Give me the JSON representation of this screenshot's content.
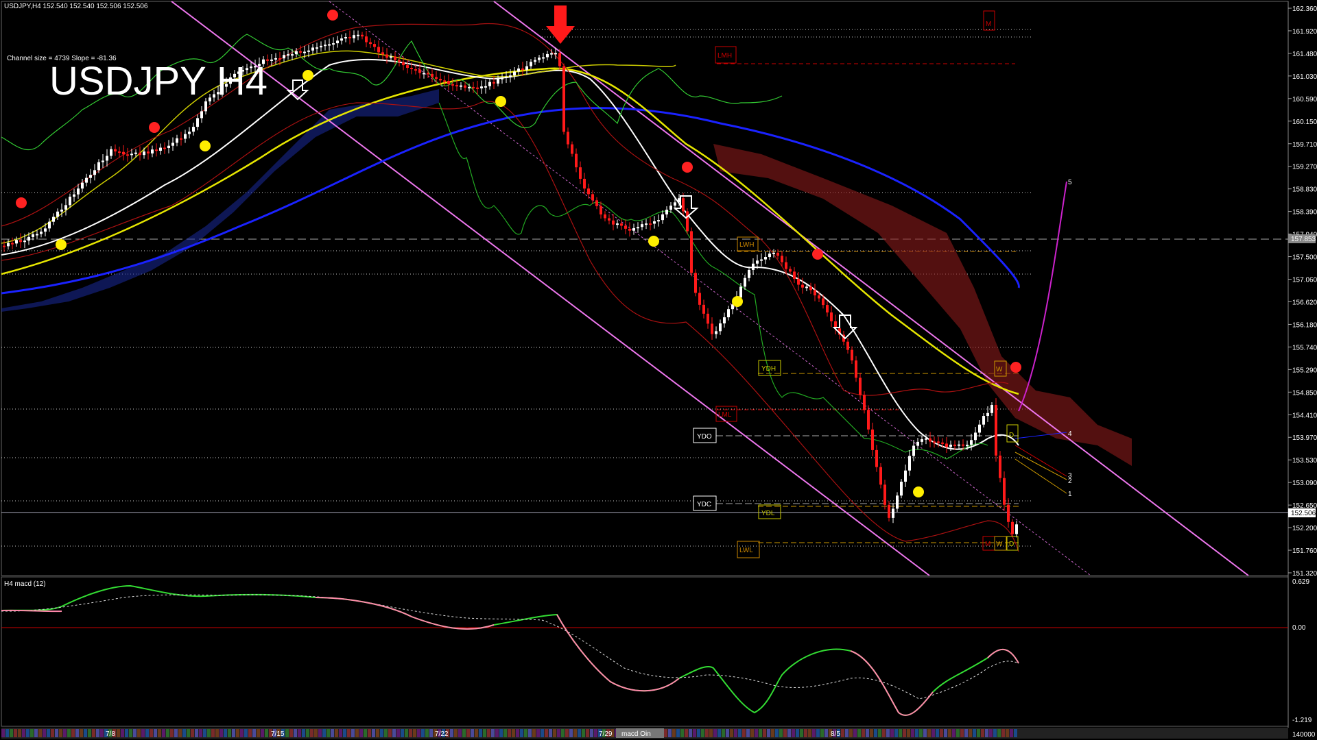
{
  "header": {
    "symbol_line": "USDJPY,H4  152.540 152.540 152.506 152.506",
    "channel_info": "Channel size = 4739 Slope = -81.36",
    "big_title": "USDJPY H4"
  },
  "price_axis": {
    "ticks": [
      "162.360",
      "161.920",
      "161.480",
      "161.030",
      "160.590",
      "160.150",
      "159.710",
      "159.270",
      "158.830",
      "158.390",
      "157.940",
      "157.500",
      "157.060",
      "156.620",
      "156.180",
      "155.740",
      "155.290",
      "154.850",
      "154.410",
      "153.970",
      "153.530",
      "153.090",
      "152.650",
      "152.200",
      "151.760",
      "151.320"
    ],
    "current_price": "152.506",
    "marker_price": "157.853"
  },
  "macd": {
    "title": "H4 macd (12)",
    "ticks": [
      "0.629",
      "0.00",
      "-1.219",
      "140000"
    ]
  },
  "date_axis": [
    "7/8",
    "7/15",
    "7/22",
    "7/29",
    "8/5"
  ],
  "date_badge": "macd Oin",
  "level_tags": {
    "lmh": "LMH",
    "m_top": "M",
    "lwh": "LWH",
    "ydh": "YDH",
    "lml": "LML",
    "ydo": "YDO",
    "ydc": "YDC",
    "ydl": "YDL",
    "lwl": "LWL",
    "w_mid": "W",
    "d_mid": "D",
    "m_bot": "M",
    "w_bot": "W",
    "d_bot": "D"
  },
  "projection_labels": [
    "5",
    "4",
    "3",
    "2",
    "1"
  ],
  "colors": {
    "background": "#000000",
    "bull_candle": "#ffffff",
    "bear_candle": "#ff1a1a",
    "channel": "#ff66ff",
    "ma_blue": "#1a1aff",
    "ma_yellow": "#e6e600",
    "ma_white": "#ffffff",
    "macd_line": "#33dd33",
    "macd_line_down": "#ff88aa",
    "level_red": "#cc0000",
    "level_orange": "#ff9900"
  }
}
